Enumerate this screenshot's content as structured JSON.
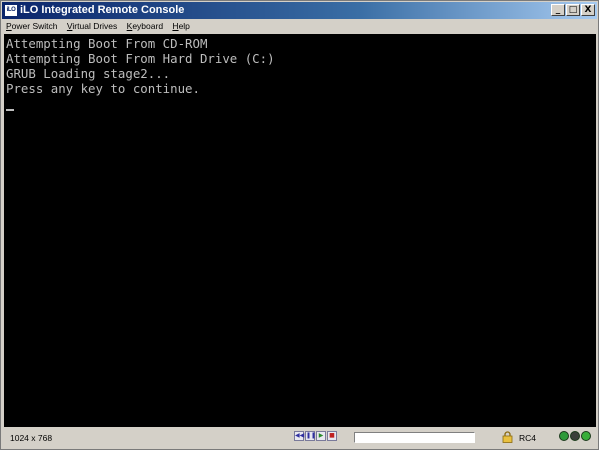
{
  "window": {
    "app_icon_text": "iLO",
    "title": "iLO Integrated Remote Console",
    "minimize_glyph": "_",
    "maximize_glyph": "□",
    "close_glyph": "X"
  },
  "menu": {
    "items": [
      {
        "accel": "P",
        "rest": "ower Switch"
      },
      {
        "accel": "V",
        "rest": "irtual Drives"
      },
      {
        "accel": "K",
        "rest": "eyboard"
      },
      {
        "accel": "H",
        "rest": "elp"
      }
    ]
  },
  "console": {
    "lines": [
      "Attempting Boot From CD-ROM",
      "Attempting Boot From Hard Drive (C:)",
      "GRUB Loading stage2...",
      "Press any key to continue."
    ],
    "text_color": "#bdbdbd",
    "background": "#000000"
  },
  "status": {
    "resolution": "1024 x 768",
    "encryption": "RC4",
    "media_buttons": [
      {
        "icon": "rewind-icon",
        "glyph": "◀◀"
      },
      {
        "icon": "pause-icon",
        "glyph": "❚❚"
      },
      {
        "icon": "play-icon",
        "glyph": "▶"
      },
      {
        "icon": "stop-icon",
        "glyph": "■"
      }
    ],
    "leds": [
      {
        "icon": "led-green-icon",
        "color": "#2f9a3a"
      },
      {
        "icon": "led-dark-icon",
        "color": "#3a3f3a"
      },
      {
        "icon": "led-power-icon",
        "color": "#3aae3a"
      }
    ]
  }
}
